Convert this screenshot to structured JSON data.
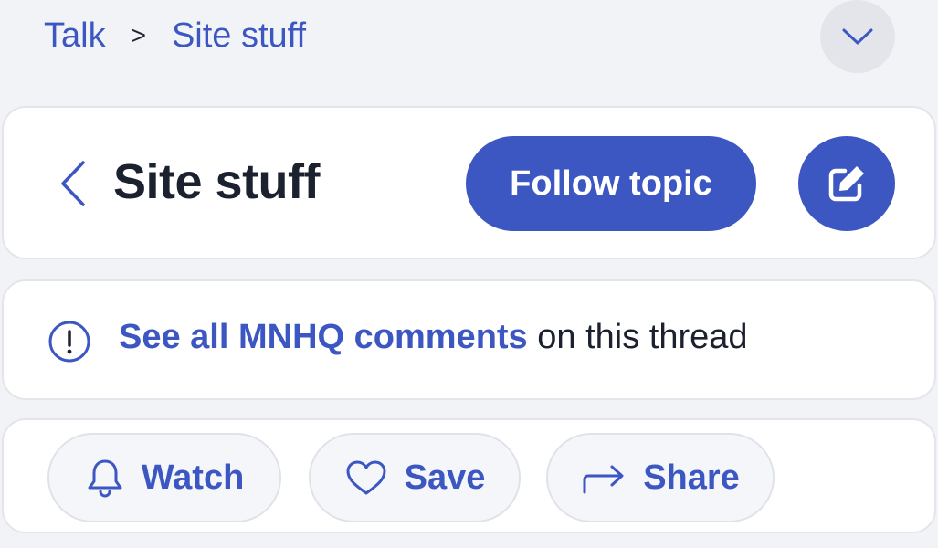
{
  "breadcrumb": {
    "root": "Talk",
    "separator": ">",
    "current": "Site stuff"
  },
  "header": {
    "title": "Site stuff",
    "follow_label": "Follow topic",
    "back_icon": "chevron-left-icon",
    "compose_icon": "edit-icon"
  },
  "notice": {
    "link_text": "See all MNHQ comments",
    "suffix_text": " on this thread",
    "icon": "info-circle-icon"
  },
  "actions": {
    "watch_label": "Watch",
    "save_label": "Save",
    "share_label": "Share"
  },
  "colors": {
    "accent": "#3d57c2",
    "background": "#f2f3f6",
    "card": "#ffffff",
    "text": "#1c2130"
  }
}
